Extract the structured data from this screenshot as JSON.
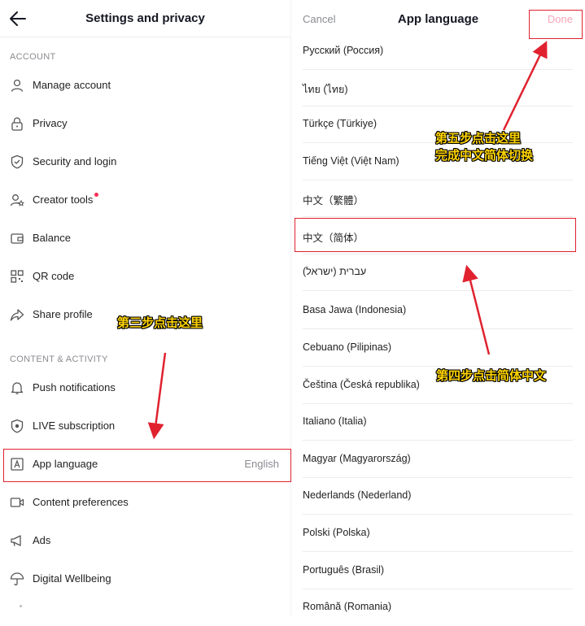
{
  "left": {
    "title": "Settings and privacy",
    "sections": {
      "account": "ACCOUNT",
      "content_activity": "CONTENT & ACTIVITY"
    },
    "items": {
      "manage_account": "Manage account",
      "privacy": "Privacy",
      "security": "Security and login",
      "creator_tools": "Creator tools",
      "balance": "Balance",
      "qr_code": "QR code",
      "share_profile": "Share profile",
      "push_notifications": "Push notifications",
      "live_subscription": "LIVE subscription",
      "app_language": "App language",
      "app_language_value": "English",
      "content_preferences": "Content preferences",
      "ads": "Ads",
      "digital_wellbeing": "Digital Wellbeing"
    }
  },
  "right": {
    "cancel": "Cancel",
    "title": "App language",
    "done": "Done",
    "languages": [
      "Русский (Россия)",
      "ไทย (ไทย)",
      "Türkçe (Türkiye)",
      "Tiếng Việt (Việt Nam)",
      "中文（繁體）",
      "中文（简体）",
      "עברית (ישראל)",
      "Basa Jawa (Indonesia)",
      "Cebuano (Pilipinas)",
      "Čeština (Česká republika)",
      "Italiano (Italia)",
      "Magyar (Magyarország)",
      "Nederlands (Nederland)",
      "Polski (Polska)",
      "Português (Brasil)",
      "Română (Romania)"
    ]
  },
  "annotations": {
    "step3": "第三步点击这里",
    "step4": "第四步点击简体中文",
    "step5_line1": "第五步点击这里",
    "step5_line2": "完成中文简体切换"
  },
  "colors": {
    "highlight": "#e0222f",
    "annotation_text": "#ffd400",
    "done_disabled": "#f7a7b7",
    "badge": "#fe2c55"
  }
}
